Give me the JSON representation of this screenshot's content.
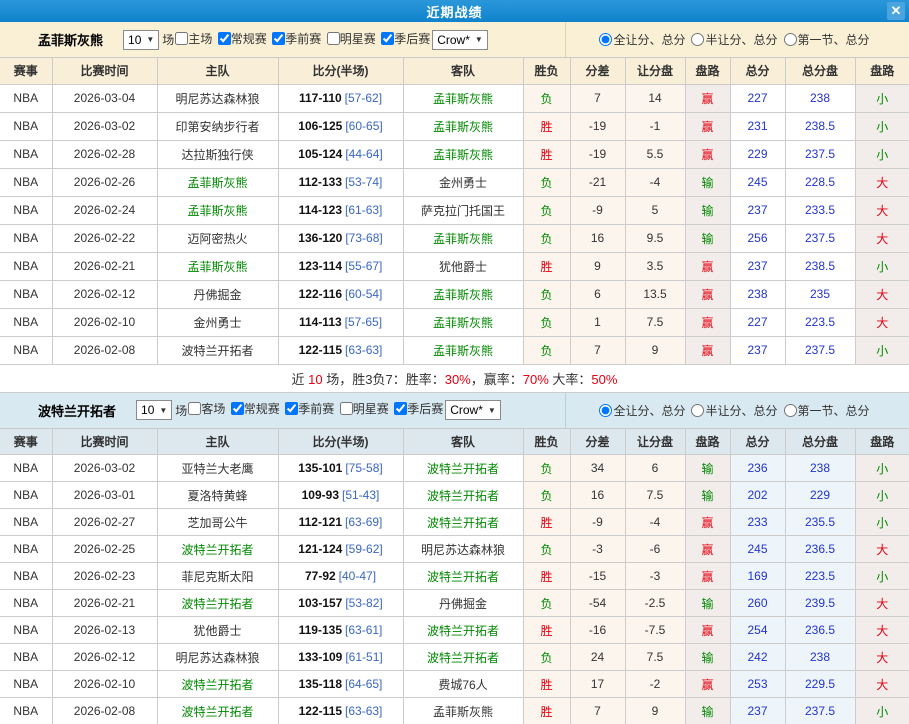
{
  "titlebar": {
    "title": "近期战绩",
    "close_glyph": "✕"
  },
  "colors": {
    "titlebar_blue": "#1189d2",
    "section1_bg": "#faf0d6",
    "section2_bg": "#d9e9f2",
    "win_red": "#e60012",
    "loss_green": "#008800",
    "value_blue": "#2233cc",
    "half_blue": "#3a66c0"
  },
  "columns": [
    "赛事",
    "比赛时间",
    "主队",
    "比分(半场)",
    "客队",
    "胜负",
    "分差",
    "让分盘",
    "盘路",
    "总分",
    "总分盘",
    "盘路"
  ],
  "sections": [
    {
      "team": "孟菲斯灰熊",
      "games_count": "10",
      "games_unit": "场",
      "checkboxes": [
        {
          "label": "主场",
          "checked": false
        },
        {
          "label": "常规赛",
          "checked": true
        },
        {
          "label": "季前赛",
          "checked": true
        },
        {
          "label": "明星赛",
          "checked": false
        },
        {
          "label": "季后赛",
          "checked": true
        }
      ],
      "type_select": "Crow*",
      "radios": [
        {
          "label": "全让分、总分",
          "selected": true
        },
        {
          "label": "半让分、总分",
          "selected": false
        },
        {
          "label": "第一节、总分",
          "selected": false
        }
      ],
      "rows": [
        {
          "league": "NBA",
          "date": "2026-03-04",
          "home": "明尼苏达森林狼",
          "home_color": "dark",
          "score": "117-110",
          "half": "[57-62]",
          "away": "孟菲斯灰熊",
          "away_color": "green",
          "result": "负",
          "result_color": "green",
          "diff": "7",
          "handicap": "14",
          "spread_outcome": "赢",
          "spread_color": "red",
          "total": "227",
          "total_line": "238",
          "total_outcome": "小",
          "total_color": "green"
        },
        {
          "league": "NBA",
          "date": "2026-03-02",
          "home": "印第安纳步行者",
          "home_color": "dark",
          "score": "106-125",
          "half": "[60-65]",
          "away": "孟菲斯灰熊",
          "away_color": "green",
          "result": "胜",
          "result_color": "red",
          "diff": "-19",
          "handicap": "-1",
          "spread_outcome": "赢",
          "spread_color": "red",
          "total": "231",
          "total_line": "238.5",
          "total_outcome": "小",
          "total_color": "green"
        },
        {
          "league": "NBA",
          "date": "2026-02-28",
          "home": "达拉斯独行侠",
          "home_color": "dark",
          "score": "105-124",
          "half": "[44-64]",
          "away": "孟菲斯灰熊",
          "away_color": "green",
          "result": "胜",
          "result_color": "red",
          "diff": "-19",
          "handicap": "5.5",
          "spread_outcome": "赢",
          "spread_color": "red",
          "total": "229",
          "total_line": "237.5",
          "total_outcome": "小",
          "total_color": "green"
        },
        {
          "league": "NBA",
          "date": "2026-02-26",
          "home": "孟菲斯灰熊",
          "home_color": "green",
          "score": "112-133",
          "half": "[53-74]",
          "away": "金州勇士",
          "away_color": "dark",
          "result": "负",
          "result_color": "green",
          "diff": "-21",
          "handicap": "-4",
          "spread_outcome": "输",
          "spread_color": "green",
          "total": "245",
          "total_line": "228.5",
          "total_outcome": "大",
          "total_color": "red"
        },
        {
          "league": "NBA",
          "date": "2026-02-24",
          "home": "孟菲斯灰熊",
          "home_color": "green",
          "score": "114-123",
          "half": "[61-63]",
          "away": "萨克拉门托国王",
          "away_color": "dark",
          "result": "负",
          "result_color": "green",
          "diff": "-9",
          "handicap": "5",
          "spread_outcome": "输",
          "spread_color": "green",
          "total": "237",
          "total_line": "233.5",
          "total_outcome": "大",
          "total_color": "red"
        },
        {
          "league": "NBA",
          "date": "2026-02-22",
          "home": "迈阿密热火",
          "home_color": "dark",
          "score": "136-120",
          "half": "[73-68]",
          "away": "孟菲斯灰熊",
          "away_color": "green",
          "result": "负",
          "result_color": "green",
          "diff": "16",
          "handicap": "9.5",
          "spread_outcome": "输",
          "spread_color": "green",
          "total": "256",
          "total_line": "237.5",
          "total_outcome": "大",
          "total_color": "red"
        },
        {
          "league": "NBA",
          "date": "2026-02-21",
          "home": "孟菲斯灰熊",
          "home_color": "green",
          "score": "123-114",
          "half": "[55-67]",
          "away": "犹他爵士",
          "away_color": "dark",
          "result": "胜",
          "result_color": "red",
          "diff": "9",
          "handicap": "3.5",
          "spread_outcome": "赢",
          "spread_color": "red",
          "total": "237",
          "total_line": "238.5",
          "total_outcome": "小",
          "total_color": "green"
        },
        {
          "league": "NBA",
          "date": "2026-02-12",
          "home": "丹佛掘金",
          "home_color": "dark",
          "score": "122-116",
          "half": "[60-54]",
          "away": "孟菲斯灰熊",
          "away_color": "green",
          "result": "负",
          "result_color": "green",
          "diff": "6",
          "handicap": "13.5",
          "spread_outcome": "赢",
          "spread_color": "red",
          "total": "238",
          "total_line": "235",
          "total_outcome": "大",
          "total_color": "red"
        },
        {
          "league": "NBA",
          "date": "2026-02-10",
          "home": "金州勇士",
          "home_color": "dark",
          "score": "114-113",
          "half": "[57-65]",
          "away": "孟菲斯灰熊",
          "away_color": "green",
          "result": "负",
          "result_color": "green",
          "diff": "1",
          "handicap": "7.5",
          "spread_outcome": "赢",
          "spread_color": "red",
          "total": "227",
          "total_line": "223.5",
          "total_outcome": "大",
          "total_color": "red"
        },
        {
          "league": "NBA",
          "date": "2026-02-08",
          "home": "波特兰开拓者",
          "home_color": "dark",
          "score": "122-115",
          "half": "[63-63]",
          "away": "孟菲斯灰熊",
          "away_color": "green",
          "result": "负",
          "result_color": "green",
          "diff": "7",
          "handicap": "9",
          "spread_outcome": "赢",
          "spread_color": "red",
          "total": "237",
          "total_line": "237.5",
          "total_outcome": "小",
          "total_color": "green"
        }
      ],
      "summary_segments": [
        {
          "text": "近 ",
          "color": "dark"
        },
        {
          "text": "10",
          "color": "red"
        },
        {
          "text": " 场，胜3负7：胜率：",
          "color": "dark"
        },
        {
          "text": "30%",
          "color": "red"
        },
        {
          "text": "，赢率：",
          "color": "dark"
        },
        {
          "text": "70%",
          "color": "red"
        },
        {
          "text": " 大率：",
          "color": "dark"
        },
        {
          "text": "50%",
          "color": "red"
        }
      ]
    },
    {
      "team": "波特兰开拓者",
      "games_count": "10",
      "games_unit": "场",
      "checkboxes": [
        {
          "label": "客场",
          "checked": false
        },
        {
          "label": "常规赛",
          "checked": true
        },
        {
          "label": "季前赛",
          "checked": true
        },
        {
          "label": "明星赛",
          "checked": false
        },
        {
          "label": "季后赛",
          "checked": true
        }
      ],
      "type_select": "Crow*",
      "radios": [
        {
          "label": "全让分、总分",
          "selected": true
        },
        {
          "label": "半让分、总分",
          "selected": false
        },
        {
          "label": "第一节、总分",
          "selected": false
        }
      ],
      "rows": [
        {
          "league": "NBA",
          "date": "2026-03-02",
          "home": "亚特兰大老鹰",
          "home_color": "dark",
          "score": "135-101",
          "half": "[75-58]",
          "away": "波特兰开拓者",
          "away_color": "green",
          "result": "负",
          "result_color": "green",
          "diff": "34",
          "handicap": "6",
          "spread_outcome": "输",
          "spread_color": "green",
          "total": "236",
          "total_line": "238",
          "total_outcome": "小",
          "total_color": "green"
        },
        {
          "league": "NBA",
          "date": "2026-03-01",
          "home": "夏洛特黄蜂",
          "home_color": "dark",
          "score": "109-93",
          "half": "[51-43]",
          "away": "波特兰开拓者",
          "away_color": "green",
          "result": "负",
          "result_color": "green",
          "diff": "16",
          "handicap": "7.5",
          "spread_outcome": "输",
          "spread_color": "green",
          "total": "202",
          "total_line": "229",
          "total_outcome": "小",
          "total_color": "green"
        },
        {
          "league": "NBA",
          "date": "2026-02-27",
          "home": "芝加哥公牛",
          "home_color": "dark",
          "score": "112-121",
          "half": "[63-69]",
          "away": "波特兰开拓者",
          "away_color": "green",
          "result": "胜",
          "result_color": "red",
          "diff": "-9",
          "handicap": "-4",
          "spread_outcome": "赢",
          "spread_color": "red",
          "total": "233",
          "total_line": "235.5",
          "total_outcome": "小",
          "total_color": "green"
        },
        {
          "league": "NBA",
          "date": "2026-02-25",
          "home": "波特兰开拓者",
          "home_color": "green",
          "score": "121-124",
          "half": "[59-62]",
          "away": "明尼苏达森林狼",
          "away_color": "dark",
          "result": "负",
          "result_color": "green",
          "diff": "-3",
          "handicap": "-6",
          "spread_outcome": "赢",
          "spread_color": "red",
          "total": "245",
          "total_line": "236.5",
          "total_outcome": "大",
          "total_color": "red"
        },
        {
          "league": "NBA",
          "date": "2026-02-23",
          "home": "菲尼克斯太阳",
          "home_color": "dark",
          "score": "77-92",
          "half": "[40-47]",
          "away": "波特兰开拓者",
          "away_color": "green",
          "result": "胜",
          "result_color": "red",
          "diff": "-15",
          "handicap": "-3",
          "spread_outcome": "赢",
          "spread_color": "red",
          "total": "169",
          "total_line": "223.5",
          "total_outcome": "小",
          "total_color": "green"
        },
        {
          "league": "NBA",
          "date": "2026-02-21",
          "home": "波特兰开拓者",
          "home_color": "green",
          "score": "103-157",
          "half": "[53-82]",
          "away": "丹佛掘金",
          "away_color": "dark",
          "result": "负",
          "result_color": "green",
          "diff": "-54",
          "handicap": "-2.5",
          "spread_outcome": "输",
          "spread_color": "green",
          "total": "260",
          "total_line": "239.5",
          "total_outcome": "大",
          "total_color": "red"
        },
        {
          "league": "NBA",
          "date": "2026-02-13",
          "home": "犹他爵士",
          "home_color": "dark",
          "score": "119-135",
          "half": "[63-61]",
          "away": "波特兰开拓者",
          "away_color": "green",
          "result": "胜",
          "result_color": "red",
          "diff": "-16",
          "handicap": "-7.5",
          "spread_outcome": "赢",
          "spread_color": "red",
          "total": "254",
          "total_line": "236.5",
          "total_outcome": "大",
          "total_color": "red"
        },
        {
          "league": "NBA",
          "date": "2026-02-12",
          "home": "明尼苏达森林狼",
          "home_color": "dark",
          "score": "133-109",
          "half": "[61-51]",
          "away": "波特兰开拓者",
          "away_color": "green",
          "result": "负",
          "result_color": "green",
          "diff": "24",
          "handicap": "7.5",
          "spread_outcome": "输",
          "spread_color": "green",
          "total": "242",
          "total_line": "238",
          "total_outcome": "大",
          "total_color": "red"
        },
        {
          "league": "NBA",
          "date": "2026-02-10",
          "home": "波特兰开拓者",
          "home_color": "green",
          "score": "135-118",
          "half": "[64-65]",
          "away": "费城76人",
          "away_color": "dark",
          "result": "胜",
          "result_color": "red",
          "diff": "17",
          "handicap": "-2",
          "spread_outcome": "赢",
          "spread_color": "red",
          "total": "253",
          "total_line": "229.5",
          "total_outcome": "大",
          "total_color": "red"
        },
        {
          "league": "NBA",
          "date": "2026-02-08",
          "home": "波特兰开拓者",
          "home_color": "green",
          "score": "122-115",
          "half": "[63-63]",
          "away": "孟菲斯灰熊",
          "away_color": "dark",
          "result": "胜",
          "result_color": "red",
          "diff": "7",
          "handicap": "9",
          "spread_outcome": "输",
          "spread_color": "green",
          "total": "237",
          "total_line": "237.5",
          "total_outcome": "小",
          "total_color": "green"
        }
      ]
    }
  ]
}
